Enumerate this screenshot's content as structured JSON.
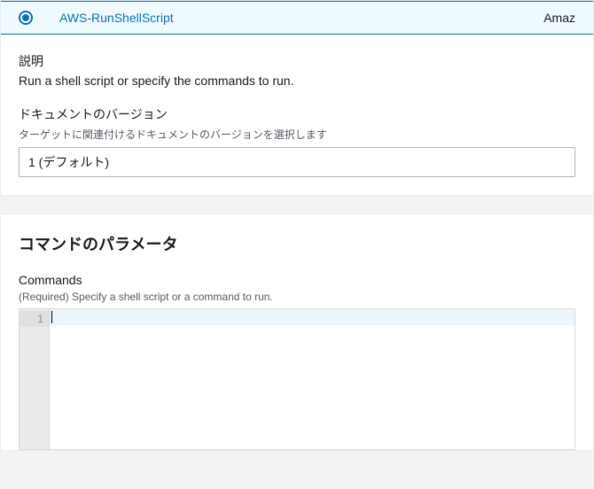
{
  "document": {
    "selected_name": "AWS-RunShellScript",
    "owner_partial": "Amaz"
  },
  "description": {
    "label": "説明",
    "text": "Run a shell script or specify the commands to run."
  },
  "doc_version": {
    "label": "ドキュメントのバージョン",
    "helper": "ターゲットに関連付けるドキュメントのバージョンを選択します",
    "selected": "1 (デフォルト)"
  },
  "parameters": {
    "heading": "コマンドのパラメータ",
    "commands": {
      "label": "Commands",
      "helper": "(Required) Specify a shell script or a command to run.",
      "line_number": "1",
      "value": ""
    }
  }
}
